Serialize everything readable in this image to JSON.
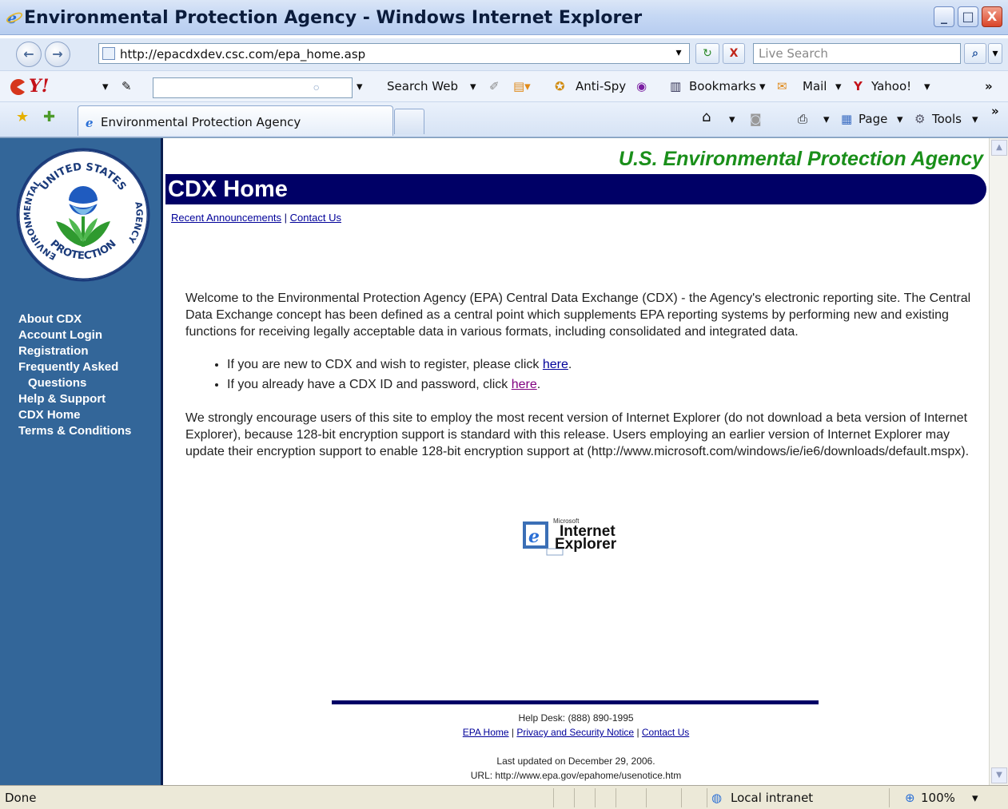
{
  "window": {
    "title": "Environmental Protection Agency - Windows Internet Explorer",
    "minimize": "_",
    "maximize": "□",
    "close": "X"
  },
  "address_bar": {
    "back": "←",
    "forward": "→",
    "url": "http://epacdxdev.csc.com/epa_home.asp",
    "go": "↻",
    "stop": "X",
    "search_placeholder": "Live Search",
    "search_button": "⌕"
  },
  "yahoo_toolbar": {
    "logo": "Y!",
    "search_web": "Search Web",
    "anti_spy": "Anti-Spy",
    "bookmarks": "Bookmarks",
    "mail": "Mail",
    "yahoo": "Yahoo!",
    "more": "»"
  },
  "tab_bar": {
    "tab_label": "Environmental Protection Agency",
    "page_menu": "Page",
    "tools_menu": "Tools",
    "more": "»"
  },
  "page": {
    "agency_banner": "U.S. Environmental Protection Agency",
    "heading": "CDX Home",
    "top_links": [
      "Recent Announcements",
      "Contact Us"
    ],
    "sidebar_nav": [
      "About CDX",
      "Account Login",
      "Registration",
      "Frequently Asked",
      "Questions",
      "Help & Support",
      "CDX Home",
      "Terms & Conditions"
    ],
    "intro": "Welcome to the Environmental Protection Agency (EPA) Central Data Exchange (CDX) - the Agency's electronic reporting site. The Central Data Exchange concept has been defined as a central point which supplements EPA reporting systems by performing new and existing functions for receiving legally acceptable data in various formats, including consolidated and integrated data.",
    "bullets": [
      {
        "text": "If you are new to CDX and wish to register, please click ",
        "link": "here",
        "end": "."
      },
      {
        "text": "If you already have a CDX ID and password, click ",
        "link": "here",
        "end": "."
      }
    ],
    "browser_note": "We strongly encourage users of this site to employ the most recent version of Internet Explorer (do not download a beta version of Internet Explorer), because 128-bit encryption support is standard with this release. Users employing an earlier version of Internet Explorer may update their encryption support to enable 128-bit encryption support at (http://www.microsoft.com/windows/ie/ie6/downloads/default.mspx).",
    "ie_logo": {
      "brand": "Microsoft",
      "line1": "Internet",
      "line2": "Explorer"
    },
    "footer": {
      "helpdesk": "Help Desk: (888) 890-1995",
      "links": [
        "EPA Home",
        "Privacy and Security Notice",
        "Contact Us"
      ],
      "last_updated": "Last updated on December 29, 2006.",
      "url": "URL: http://www.epa.gov/epahome/usenotice.htm"
    },
    "seal": {
      "top": "UNITED STATES",
      "left": "ENVIRONMENTAL",
      "bottom": "PROTECTION",
      "right": "AGENCY"
    }
  },
  "status_bar": {
    "status": "Done",
    "zone": "Local intranet",
    "zoom": "100%"
  },
  "colors": {
    "sidebar": "#336699",
    "nav_bar": "#000066",
    "banner_green": "#1a8f1a",
    "link": "#000099",
    "visited_link": "#800080"
  }
}
